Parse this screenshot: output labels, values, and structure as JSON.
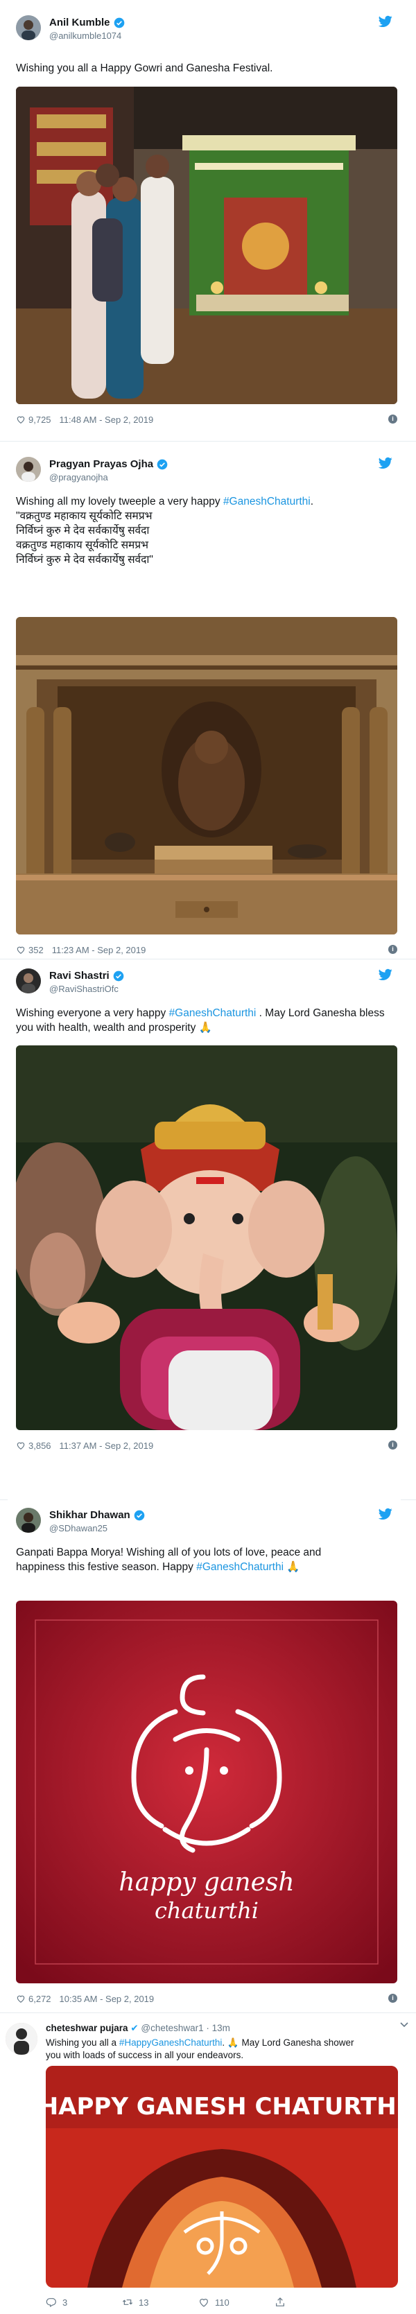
{
  "colors": {
    "link": "#1b95e0",
    "muted": "#657786",
    "verified": "#1da1f2"
  },
  "icons": {
    "verified": "verified-badge-icon",
    "twitter": "twitter-bird-icon",
    "like": "heart-icon",
    "info": "info-icon",
    "reply": "reply-icon",
    "retweet": "retweet-icon",
    "share": "share-icon"
  },
  "tweets": [
    {
      "name": "Anil Kumble",
      "handle": "@anilkumble1074",
      "text": "Wishing you all a Happy Gowri and Ganesha Festival.",
      "likes": "9,725",
      "time": "11:48 AM - Sep 2, 2019"
    },
    {
      "name": "Pragyan Prayas Ojha",
      "handle": "@pragyanojha",
      "text_prefix": "Wishing all my lovely tweeple a very happy ",
      "hashtag": "#GaneshChaturthi",
      "text_suffix": ".",
      "lines": [
        "\"वक्रतुण्ड महाकाय सूर्यकोटि समप्रभ",
        "निर्विघ्नं कुरु मे देव सर्वकार्येषु सर्वदा",
        "वक्रतुण्ड महाकाय सूर्यकोटि समप्रभ",
        "निर्विघ्नं कुरु मे देव सर्वकार्येषु सर्वदा\""
      ],
      "likes": "352",
      "time": "11:23 AM - Sep 2, 2019"
    },
    {
      "name": "Ravi Shastri",
      "handle": "@RaviShastriOfc",
      "text_prefix": "Wishing everyone a very happy ",
      "hashtag": "#GaneshChaturthi",
      "text_suffix": " . May Lord Ganesha bless you with health, wealth and prosperity 🙏",
      "likes": "3,856",
      "time": "11:37 AM - Sep 2, 2019"
    },
    {
      "name": "Shikhar Dhawan",
      "handle": "@SDhawan25",
      "text_line1": "Ganpati Bappa Morya! Wishing all of you lots of love, peace and",
      "text_prefix": "happiness this festive season. Happy ",
      "hashtag": "#GaneshChaturthi",
      "text_suffix": " 🙏",
      "image_text_1": "happy ganesh",
      "image_text_2": "chaturthi",
      "likes": "6,272",
      "time": "10:35 AM - Sep 2, 2019"
    },
    {
      "name": "cheteshwar pujara",
      "handle": "@cheteshwar1",
      "age": "· 13m",
      "text_prefix": "Wishing you all a ",
      "hashtag": "#HappyGaneshChaturthi",
      "text_suffix": ". 🙏 May Lord Ganesha shower",
      "text_line2": "you with loads of success in all your endeavors.",
      "image_text": "HAPPY GANESH CHATURTHI",
      "replies": "3",
      "retweets": "13",
      "likes": "110"
    }
  ]
}
